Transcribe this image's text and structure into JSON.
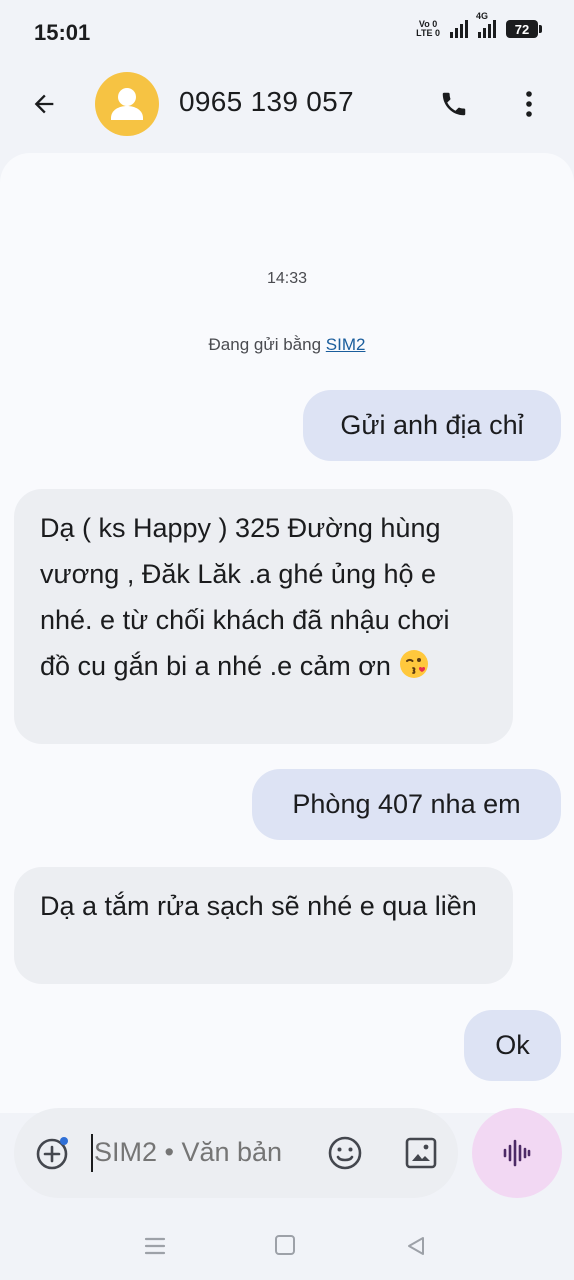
{
  "status_bar": {
    "time": "15:01",
    "volte_top": "Vo 0",
    "volte_bottom": "LTE 0",
    "network_4g": "4G",
    "battery": "72"
  },
  "header": {
    "contact_name": "0965 139 057",
    "avatar_color": "#f6c343"
  },
  "conversation": {
    "timestamp": "14:33",
    "sending_via": "Đang gửi bằng",
    "sim_name": "SIM2",
    "messages": [
      {
        "direction": "outgoing",
        "text": "Gửi anh địa chỉ"
      },
      {
        "direction": "incoming",
        "text": "Dạ ( ks Happy ) 325 Đường hùng vương , Đăk Lăk .a ghé ủng hộ e nhé. e từ chối khách đã nhậu chơi đồ cu gắn bi a nhé .e cảm ơn",
        "emoji": "kissing-face"
      },
      {
        "direction": "outgoing",
        "text": "Phòng 407 nha em"
      },
      {
        "direction": "incoming",
        "text": "Dạ a tắm rửa sạch sẽ nhé e qua liền"
      },
      {
        "direction": "outgoing",
        "text": "Ok"
      }
    ]
  },
  "composer": {
    "placeholder": "SIM2 • Văn bản"
  },
  "colors": {
    "outgoing_bubble": "#dde3f4",
    "incoming_bubble": "#eceef2",
    "voice_button": "#f2d8f3",
    "link": "#1a5d9c"
  }
}
